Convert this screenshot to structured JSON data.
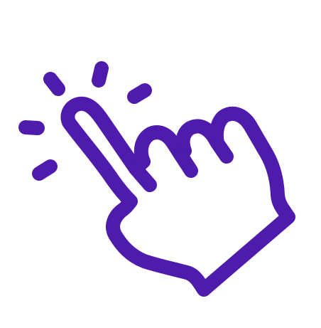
{
  "icon": {
    "name": "tap-click-hand-icon",
    "stroke_color": "#4F1BAD",
    "fill_color": "#FFFFFF",
    "background_color": "#FFFFFF"
  }
}
